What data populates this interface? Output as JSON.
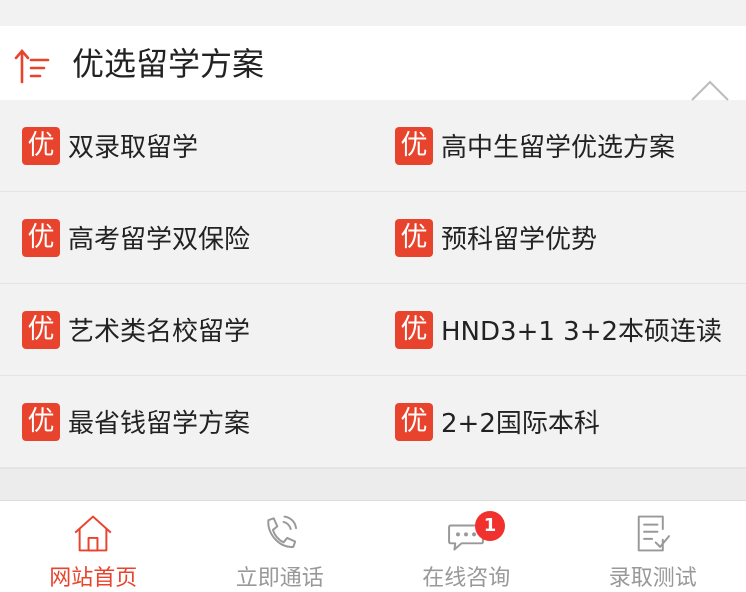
{
  "section": {
    "title": "优选留学方案"
  },
  "badge_char": "优",
  "options": [
    [
      "双录取留学",
      "高中生留学优选方案"
    ],
    [
      "高考留学双保险",
      "预科留学优势"
    ],
    [
      "艺术类名校留学",
      "HND3+1 3+2本硕连读"
    ],
    [
      "最省钱留学方案",
      "2+2国际本科"
    ]
  ],
  "colors": {
    "accent": "#e8442d",
    "tab_inactive": "#999999",
    "notification": "#f0312d"
  },
  "tabs": [
    {
      "label": "网站首页",
      "icon": "home-icon",
      "active": true
    },
    {
      "label": "立即通话",
      "icon": "phone-icon",
      "active": false
    },
    {
      "label": "在线咨询",
      "icon": "chat-icon",
      "active": false,
      "badge": "1"
    },
    {
      "label": "录取测试",
      "icon": "checklist-icon",
      "active": false
    }
  ]
}
